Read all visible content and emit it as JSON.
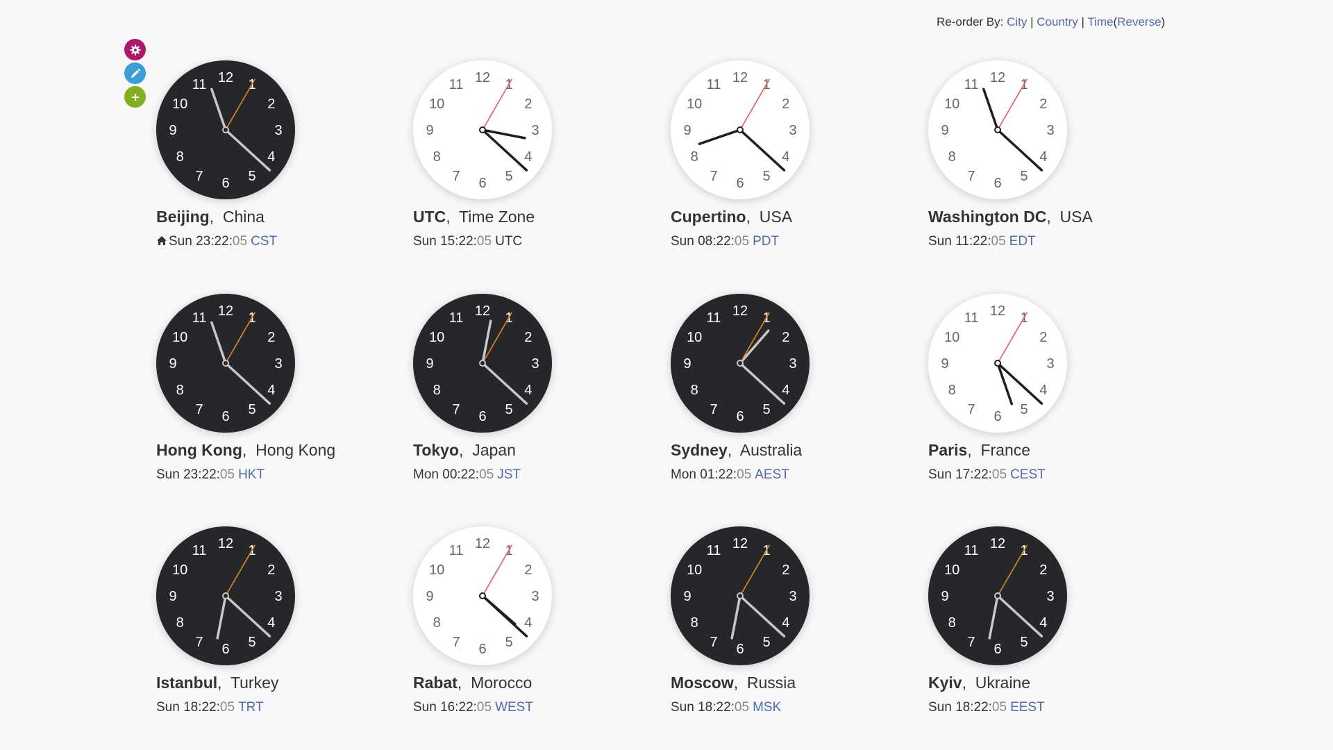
{
  "reorder": {
    "label": "Re-order By:",
    "city": "City",
    "country": "Country",
    "time": "Time",
    "reverse": "Reverse",
    "sep": "|",
    "open_paren": "(",
    "close_paren": ")"
  },
  "tools": {
    "settings_icon": "gear-icon",
    "edit_icon": "pencil-icon",
    "add_icon": "plus-icon"
  },
  "colors": {
    "accent_link": "#4e6bb0",
    "dark_dial": "#25272b",
    "light_dial": "#ffffff",
    "second_hand_dark": "#e08a1a",
    "second_hand_light": "#e9595e",
    "settings": "#b0186a",
    "edit": "#3a9fd6",
    "add": "#7fb01d"
  },
  "clocks": [
    {
      "city": "Beijing",
      "country": "China",
      "day": "Sun",
      "hm": "23:22",
      "sec": "05",
      "tz": "CST",
      "tz_link": true,
      "home": true,
      "theme": "dark",
      "hour": 23,
      "minute": 22,
      "second": 5
    },
    {
      "city": "UTC",
      "country": "Time Zone",
      "day": "Sun",
      "hm": "15:22",
      "sec": "05",
      "tz": "UTC",
      "tz_link": false,
      "home": false,
      "theme": "light",
      "hour": 15,
      "minute": 22,
      "second": 5
    },
    {
      "city": "Cupertino",
      "country": "USA",
      "day": "Sun",
      "hm": "08:22",
      "sec": "05",
      "tz": "PDT",
      "tz_link": true,
      "home": false,
      "theme": "light",
      "hour": 8,
      "minute": 22,
      "second": 5
    },
    {
      "city": "Washington DC",
      "country": "USA",
      "day": "Sun",
      "hm": "11:22",
      "sec": "05",
      "tz": "EDT",
      "tz_link": true,
      "home": false,
      "theme": "light",
      "hour": 11,
      "minute": 22,
      "second": 5
    },
    {
      "city": "Hong Kong",
      "country": "Hong Kong",
      "day": "Sun",
      "hm": "23:22",
      "sec": "05",
      "tz": "HKT",
      "tz_link": true,
      "home": false,
      "theme": "dark",
      "hour": 23,
      "minute": 22,
      "second": 5
    },
    {
      "city": "Tokyo",
      "country": "Japan",
      "day": "Mon",
      "hm": "00:22",
      "sec": "05",
      "tz": "JST",
      "tz_link": true,
      "home": false,
      "theme": "dark",
      "hour": 0,
      "minute": 22,
      "second": 5
    },
    {
      "city": "Sydney",
      "country": "Australia",
      "day": "Mon",
      "hm": "01:22",
      "sec": "05",
      "tz": "AEST",
      "tz_link": true,
      "home": false,
      "theme": "dark",
      "hour": 1,
      "minute": 22,
      "second": 5
    },
    {
      "city": "Paris",
      "country": "France",
      "day": "Sun",
      "hm": "17:22",
      "sec": "05",
      "tz": "CEST",
      "tz_link": true,
      "home": false,
      "theme": "light",
      "hour": 17,
      "minute": 22,
      "second": 5
    },
    {
      "city": "Istanbul",
      "country": "Turkey",
      "day": "Sun",
      "hm": "18:22",
      "sec": "05",
      "tz": "TRT",
      "tz_link": true,
      "home": false,
      "theme": "dark",
      "hour": 18,
      "minute": 22,
      "second": 5
    },
    {
      "city": "Rabat",
      "country": "Morocco",
      "day": "Sun",
      "hm": "16:22",
      "sec": "05",
      "tz": "WEST",
      "tz_link": true,
      "home": false,
      "theme": "light",
      "hour": 16,
      "minute": 22,
      "second": 5
    },
    {
      "city": "Moscow",
      "country": "Russia",
      "day": "Sun",
      "hm": "18:22",
      "sec": "05",
      "tz": "MSK",
      "tz_link": true,
      "home": false,
      "theme": "dark",
      "hour": 18,
      "minute": 22,
      "second": 5
    },
    {
      "city": "Kyiv",
      "country": "Ukraine",
      "day": "Sun",
      "hm": "18:22",
      "sec": "05",
      "tz": "EEST",
      "tz_link": true,
      "home": false,
      "theme": "dark",
      "hour": 18,
      "minute": 22,
      "second": 5
    }
  ]
}
